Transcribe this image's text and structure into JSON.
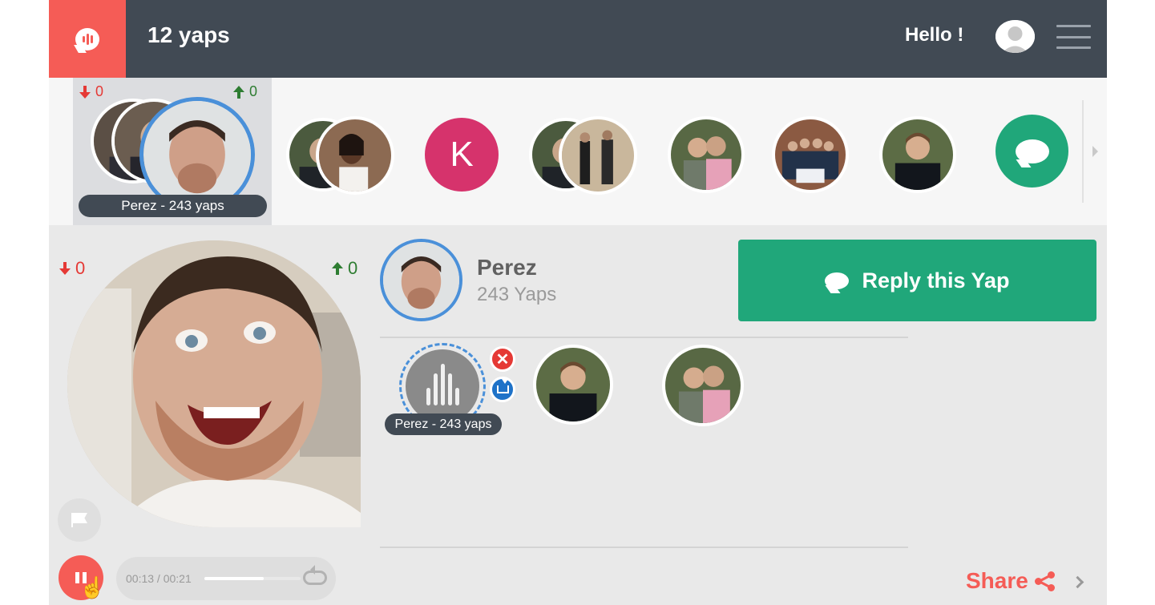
{
  "header": {
    "title": "12 yaps",
    "greeting": "Hello !",
    "logo_icon": "yap-logo-icon",
    "menu_icon": "hamburger-icon"
  },
  "strip": {
    "selected": {
      "down": "0",
      "up": "0",
      "label": "Perez - 243 yaps"
    },
    "k_initial": "K",
    "new_yap_icon": "chat-bubble-icon"
  },
  "main": {
    "down": "0",
    "up": "0",
    "profile": {
      "name": "Perez",
      "count": "243 Yaps"
    },
    "reply_button": "Reply this Yap",
    "reply_label": "Perez - 243 yaps",
    "player": {
      "time": "00:13 / 00:21",
      "progress": 0.62
    },
    "share": "Share"
  },
  "colors": {
    "header": "#414a54",
    "accent_red": "#f55c56",
    "green": "#20a77a",
    "blue_ring": "#4a90d9"
  }
}
